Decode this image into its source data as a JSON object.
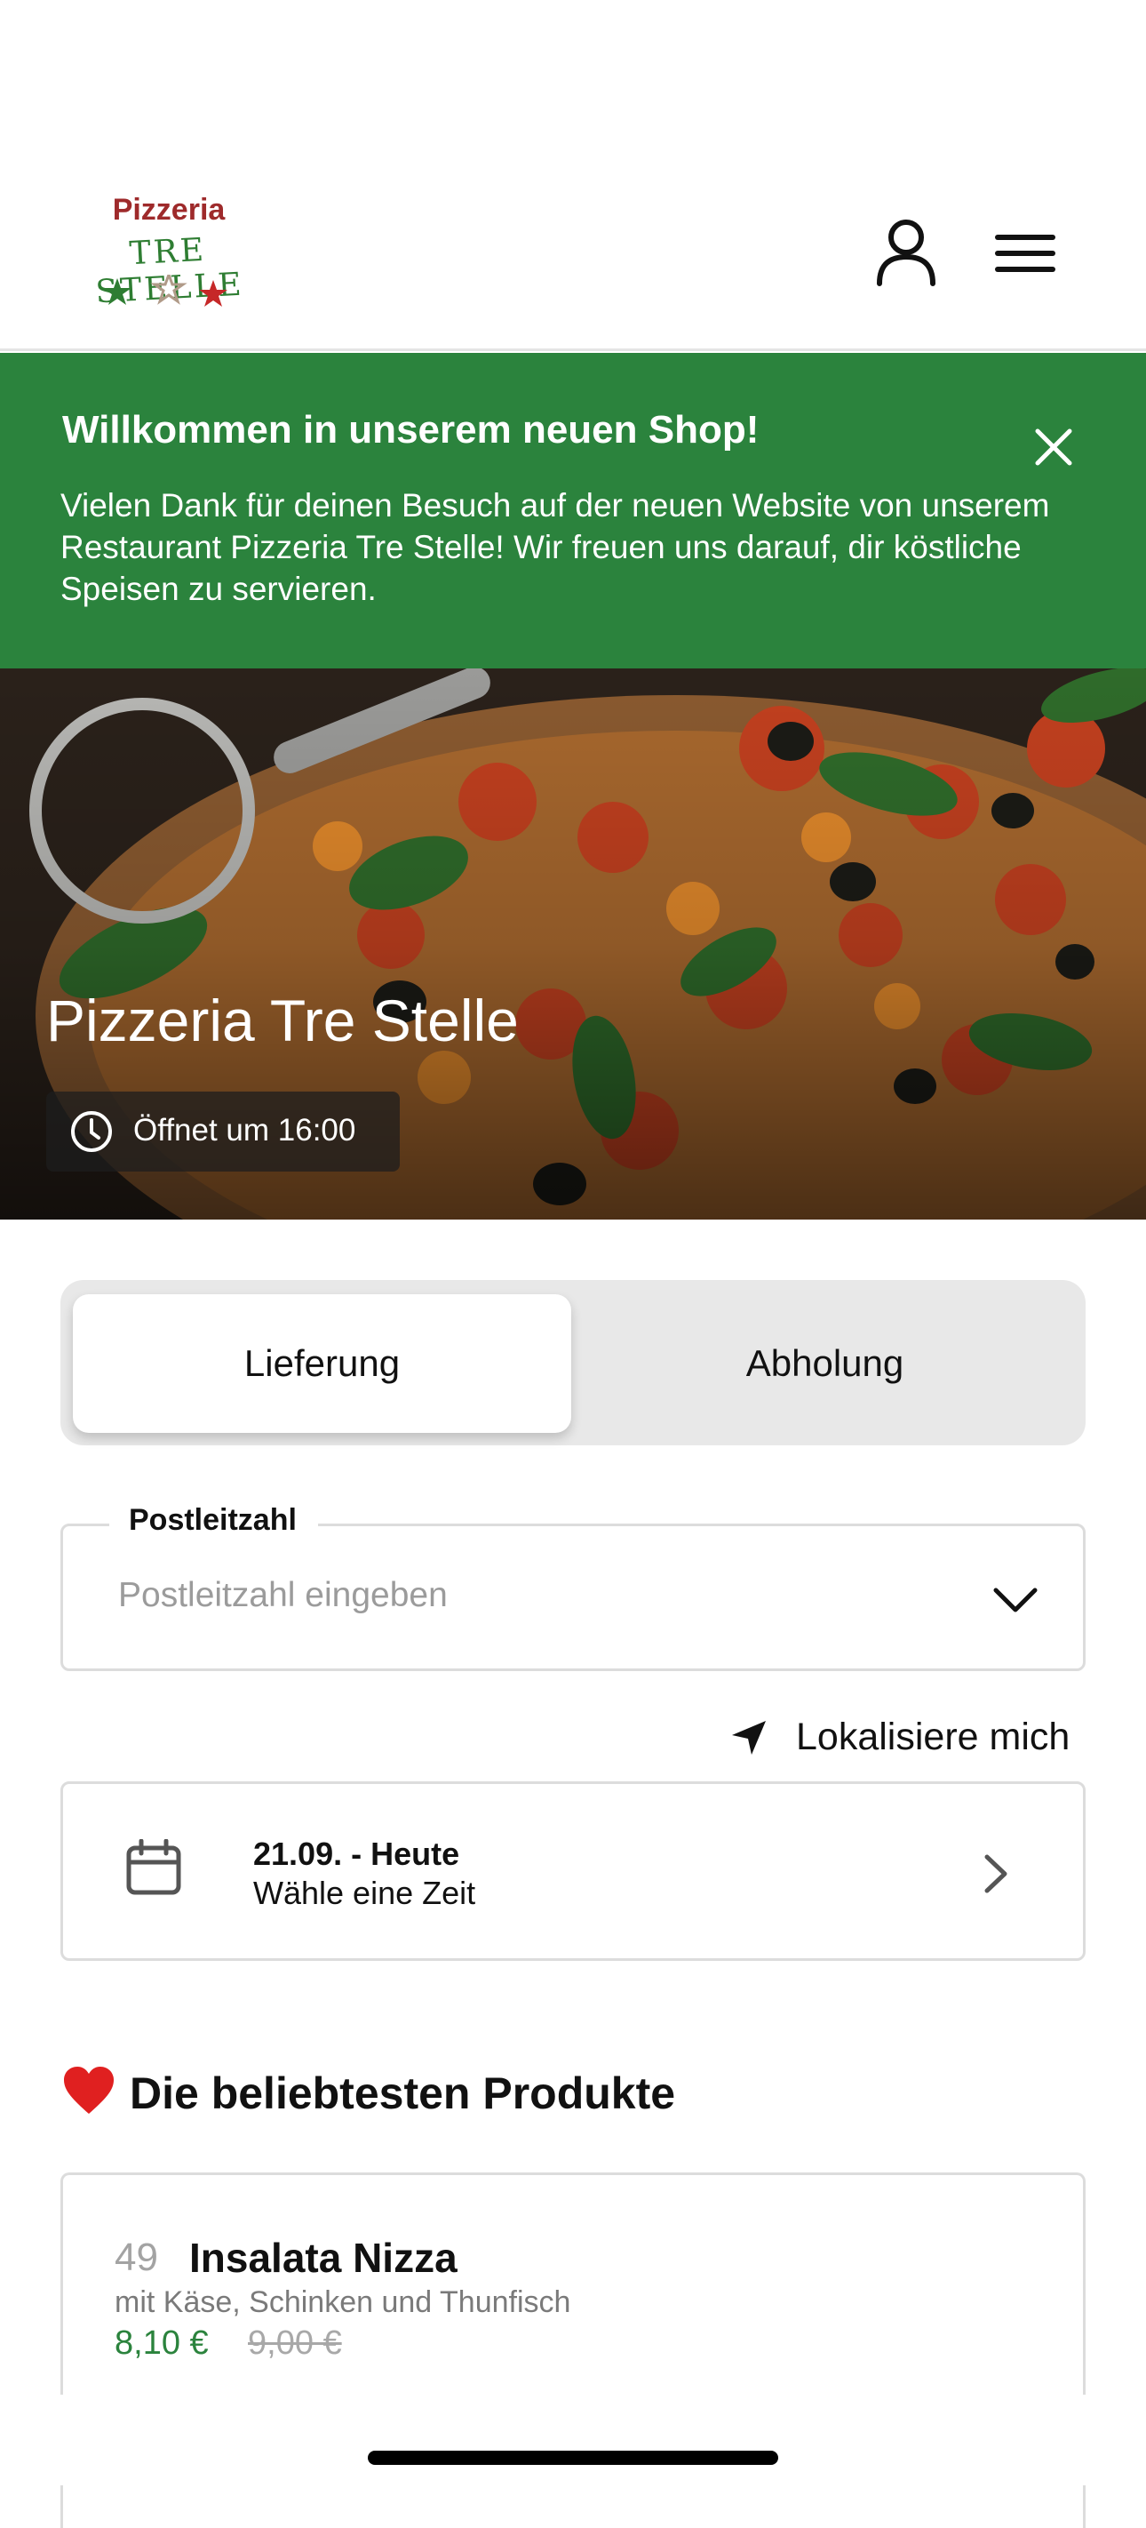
{
  "header": {
    "logo_word": "Pizzeria",
    "logo_sub": "TRE STELLE",
    "user_icon": "user-icon",
    "menu_icon": "menu-icon"
  },
  "banner": {
    "title": "Willkommen in unserem neuen Shop!",
    "text": "Vielen Dank für deinen Besuch auf der neuen Website von unserem Restaurant Pizzeria Tre Stelle! Wir freuen uns darauf, dir köstliche Speisen zu servieren.",
    "close_icon": "close-icon",
    "background_color": "#2b833d"
  },
  "hero": {
    "title": "Pizzeria Tre Stelle",
    "opening": "Öffnet um 16:00",
    "clock_icon": "clock-icon"
  },
  "order_mode": {
    "options": [
      "Lieferung",
      "Abholung"
    ],
    "selected": "Lieferung"
  },
  "postal": {
    "label": "Postleitzahl",
    "placeholder": "Postleitzahl eingeben",
    "value": ""
  },
  "locate": {
    "label": "Lokalisiere mich",
    "icon": "location-arrow-icon"
  },
  "date_picker": {
    "date": "21.09. - Heute",
    "subtitle": "Wähle eine Zeit",
    "icon": "calendar-icon"
  },
  "popular": {
    "title": "Die beliebtesten Produkte",
    "icon": "heart-icon",
    "products": [
      {
        "number": "49",
        "name": "Insalata Nizza",
        "description": "mit Käse, Schinken und Thunfisch",
        "price": "8,10 €",
        "old_price": "9,00 €"
      }
    ]
  },
  "colors": {
    "accent_green": "#2b833d",
    "logo_red": "#9e2a2b"
  }
}
